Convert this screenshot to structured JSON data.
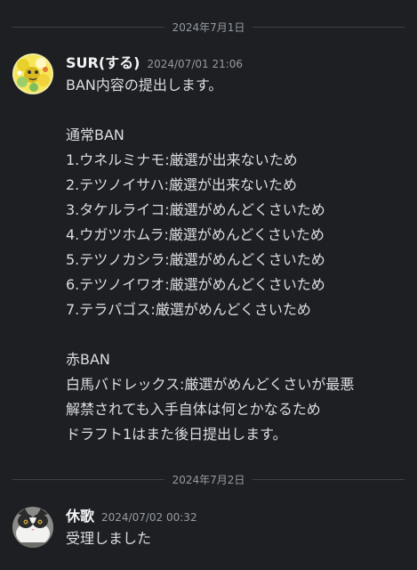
{
  "dividers": [
    {
      "date": "2024年7月1日"
    },
    {
      "date": "2024年7月2日"
    }
  ],
  "messages": [
    {
      "username": "SUR(する)",
      "timestamp": "2024/07/01 21:06",
      "lines": [
        "BAN内容の提出します。",
        "",
        "通常BAN",
        "1.ウネルミナモ:厳選が出来ないため",
        "2.テツノイサハ:厳選が出来ないため",
        "3.タケルライコ:厳選がめんどくさいため",
        "4.ウガツホムラ:厳選がめんどくさいため",
        "5.テツノカシラ:厳選がめんどくさいため",
        "6.テツノイワオ:厳選がめんどくさいため",
        "7.テラパゴス:厳選がめんどくさいため",
        "",
        "赤BAN",
        "白馬バドレックス:厳選がめんどくさいが最悪",
        "解禁されても入手自体は何とかなるため",
        "ドラフト1はまた後日提出します。"
      ]
    },
    {
      "username": "休歌",
      "timestamp": "2024/07/02 00:32",
      "lines": [
        "受理しました"
      ]
    }
  ],
  "colors": {
    "background": "#1e1f22",
    "text": "#dbdee1",
    "muted": "#949ba4",
    "divider": "#3f4147"
  }
}
